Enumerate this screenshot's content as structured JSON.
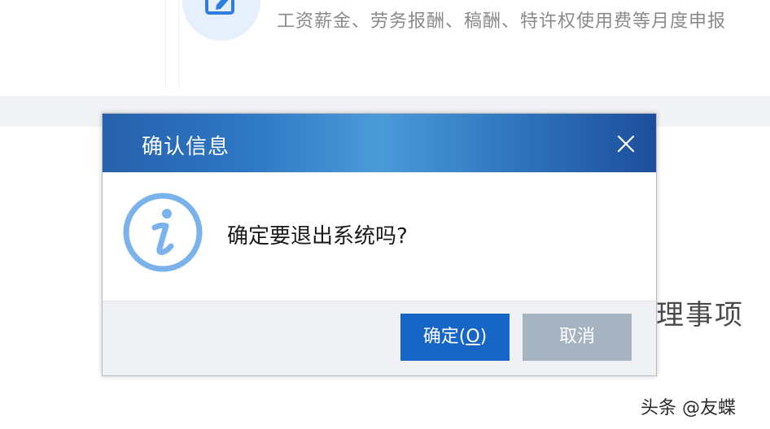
{
  "background": {
    "description_text": "工资薪金、劳务报酬、稿酬、特许权使用费等月度申报",
    "section_heading": "理事项",
    "watermark": "头条 @友蝶",
    "icon": "edit-form-icon"
  },
  "dialog": {
    "title": "确认信息",
    "message": "确定要退出系统吗?",
    "close_icon": "close-icon",
    "info_icon": "info-icon",
    "buttons": {
      "ok_label": "确定(",
      "ok_mnemonic": "O",
      "ok_suffix": ")",
      "cancel_label": "取消"
    }
  },
  "colors": {
    "header_gradient_start": "#2661ad",
    "header_gradient_mid": "#4a9ad8",
    "ok_button": "#1666c6",
    "cancel_button": "#a6b4c2",
    "info_icon": "#7ab2ec"
  }
}
